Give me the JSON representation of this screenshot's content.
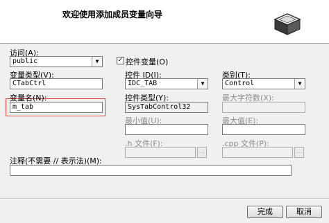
{
  "header": {
    "title": "欢迎使用添加成员变量向导",
    "icon": "wizard-box-icon"
  },
  "access": {
    "label": "访问(A):",
    "value": "public"
  },
  "control_var": {
    "label": "控件变量(O)",
    "checked": true
  },
  "var_type": {
    "label": "变量类型(V):",
    "value": "CTabCtrl"
  },
  "control_id": {
    "label": "控件 ID(I):",
    "value": "IDC_TAB"
  },
  "category": {
    "label": "类别(T):",
    "value": "Control"
  },
  "var_name": {
    "label": "变量名(N):",
    "value": "m_tab"
  },
  "control_type": {
    "label": "控件类型(Y):",
    "value": "SysTabControl32"
  },
  "max_chars": {
    "label": "最大字符数(X):"
  },
  "min_value": {
    "label": "最小值(U):"
  },
  "max_value": {
    "label": "最大值(E):"
  },
  "h_file": {
    "label": ".h 文件(F):",
    "browse": "..."
  },
  "cpp_file": {
    "label": ".cpp 文件(P):",
    "browse": "..."
  },
  "comment": {
    "label": "注释(不需要 // 表示法)(M):"
  },
  "buttons": {
    "finish": "完成",
    "cancel": "取消"
  },
  "colors": {
    "highlight": "#e2413d",
    "background": "#f0f0f0"
  }
}
